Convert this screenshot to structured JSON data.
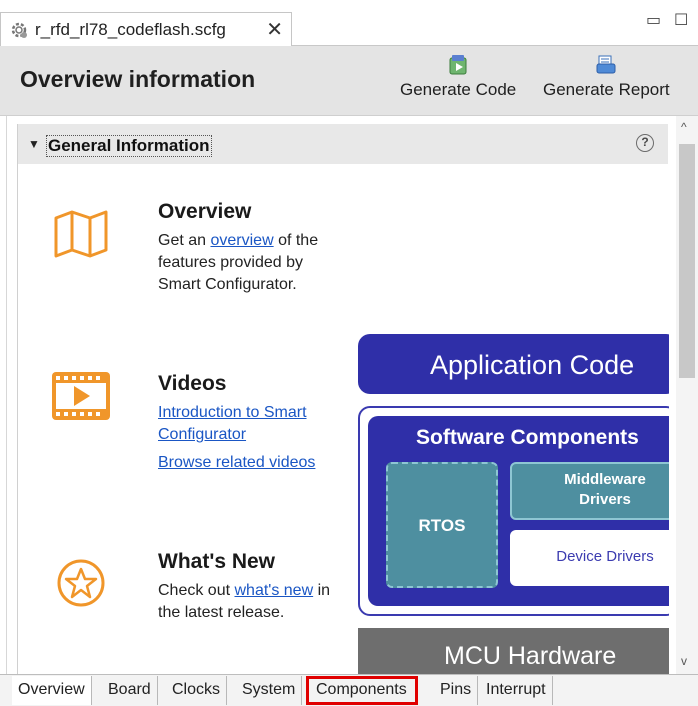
{
  "editor_tab": {
    "title": "r_rfd_rl78_codeflash.scfg",
    "icon": "gear-icon",
    "close_symbol": "✕"
  },
  "window_controls": {
    "minimize_symbol": "▭",
    "maximize_symbol": "☐"
  },
  "header": {
    "title": "Overview information",
    "generate_code_label": "Generate Code",
    "generate_report_label": "Generate Report"
  },
  "section": {
    "title": "General Information",
    "help_symbol": "?"
  },
  "overview": {
    "heading": "Overview",
    "text_before": "Get an ",
    "link": "overview",
    "text_after": " of the features provided by Smart Configurator."
  },
  "videos": {
    "heading": "Videos",
    "link1": "Introduction to Smart Configurator",
    "link2": "Browse related videos"
  },
  "whats_new": {
    "heading": "What's New",
    "text_before": "Check out ",
    "link": "what's new",
    "text_after": " in the latest release."
  },
  "diagram": {
    "application_code": "Application Code",
    "software_components": "Software Components",
    "rtos": "RTOS",
    "middleware": "Middleware",
    "drivers": "Drivers",
    "device_drivers": "Device Drivers",
    "mcu_hardware": "MCU Hardware"
  },
  "bottom_tabs": [
    "Overview",
    "Board",
    "Clocks",
    "System",
    "Components",
    "Pins",
    "Interrupt"
  ],
  "active_tab": "Overview",
  "highlighted_tab": "Components",
  "colors": {
    "accent_orange": "#f0962a",
    "diagram_blue": "#2f2fa8",
    "diagram_teal": "#4e8fa0",
    "highlight_red": "#e00000"
  }
}
